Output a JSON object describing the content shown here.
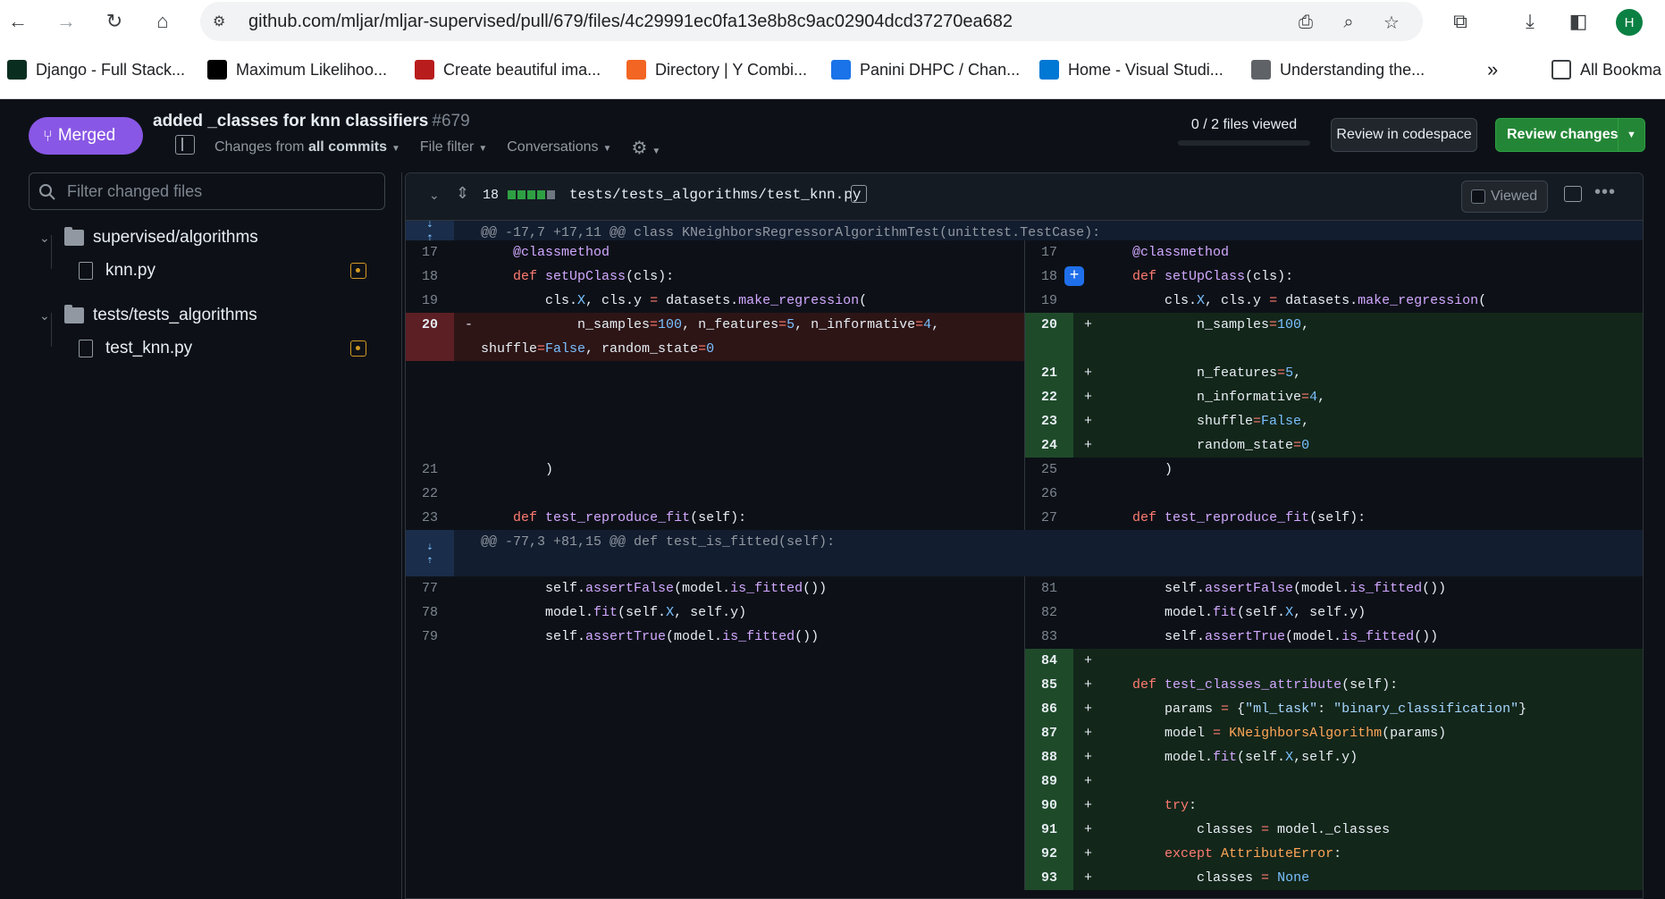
{
  "browser": {
    "url": "github.com/mljar/mljar-supervised/pull/679/files/4c29991ec0fa13e8b8c9ac02904dcd37270ea682",
    "profile_initial": "H",
    "bookmarks": [
      {
        "label": "Django - Full Stack...",
        "icon": "django-icon",
        "color": "#092e20"
      },
      {
        "label": "Maximum Likelihoo...",
        "icon": "medium-icon",
        "color": "#000000"
      },
      {
        "label": "Create beautiful ima...",
        "icon": "carbon-icon",
        "color": "#b91c1c"
      },
      {
        "label": "Directory | Y Combi...",
        "icon": "ycombinator-icon",
        "color": "#f26522"
      },
      {
        "label": "Panini DHPC / Chan...",
        "icon": "wave-icon",
        "color": "#1a73e8"
      },
      {
        "label": "Home - Visual Studi...",
        "icon": "windows-icon",
        "color": "#0078d4"
      },
      {
        "label": "Understanding the...",
        "icon": "globe-icon",
        "color": "#5f6368"
      }
    ],
    "bookmarks_more": "»",
    "all_bookmarks": "All Bookma"
  },
  "pr": {
    "status": "Merged",
    "title": "added _classes for knn classifiers",
    "number": "#679",
    "changes_prefix": "Changes from",
    "changes_value": "all commits",
    "file_filter": "File filter",
    "conversations": "Conversations",
    "files_viewed": "0 / 2 files viewed",
    "review_codespace": "Review in codespace",
    "review_changes": "Review changes"
  },
  "sidebar": {
    "filter_placeholder": "Filter changed files",
    "tree": [
      {
        "type": "folder",
        "label": "supervised/algorithms"
      },
      {
        "type": "file",
        "label": "knn.py"
      },
      {
        "type": "folder",
        "label": "tests/tests_algorithms"
      },
      {
        "type": "file",
        "label": "test_knn.py"
      }
    ]
  },
  "diff": {
    "changed_count": "18",
    "path": "tests/tests_algorithms/test_knn.py",
    "viewed_label": "Viewed",
    "hunk1": "@@ -17,7 +17,11 @@ class KNeighborsRegressorAlgorithmTest(unittest.TestCase):",
    "hunk2": "@@ -77,3 +81,15 @@ def test_is_fitted(self):",
    "colors": {
      "deleted": "#5c1f24",
      "added": "#1f4a2a",
      "accent": "#1f6feb",
      "merged": "#8957e5"
    }
  }
}
